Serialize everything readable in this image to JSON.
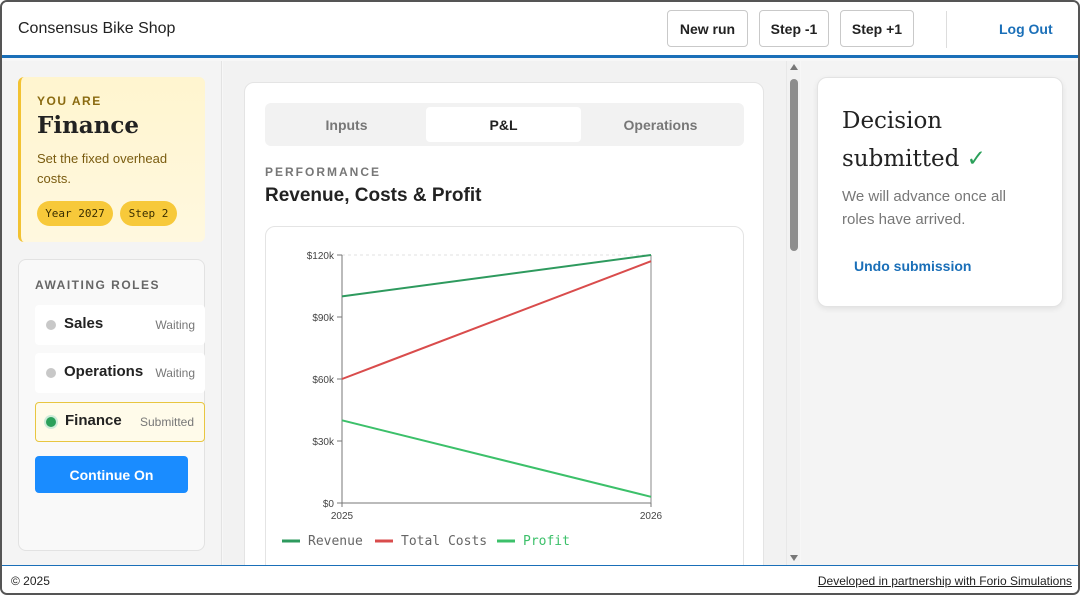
{
  "header": {
    "app_title": "Consensus Bike Shop",
    "new_run": "New run",
    "step_back": "Step -1",
    "step_forward": "Step +1",
    "logout": "Log Out"
  },
  "role_card": {
    "you_are": "YOU ARE",
    "role": "Finance",
    "description": "Set the fixed overhead costs.",
    "year_pill": "Year 2027",
    "step_pill": "Step 2"
  },
  "awaiting": {
    "title": "AWAITING ROLES",
    "roles": [
      {
        "name": "Sales",
        "status": "Waiting"
      },
      {
        "name": "Operations",
        "status": "Waiting"
      },
      {
        "name": "Finance",
        "status": "Submitted"
      }
    ],
    "continue": "Continue On"
  },
  "tabs": [
    "Inputs",
    "P&L",
    "Operations"
  ],
  "performance": {
    "label": "PERFORMANCE",
    "title": "Revenue, Costs & Profit"
  },
  "chart_data": {
    "type": "line",
    "x": [
      "2025",
      "2026"
    ],
    "ylim": [
      0,
      120000
    ],
    "yticks": [
      "$0",
      "$30k",
      "$60k",
      "$90k",
      "$120k"
    ],
    "series": [
      {
        "name": "Revenue",
        "values": [
          100000,
          120000
        ],
        "color": "#2e9a5e"
      },
      {
        "name": "Total Costs",
        "values": [
          60000,
          117000
        ],
        "color": "#d94c4c"
      },
      {
        "name": "Profit",
        "values": [
          40000,
          3000
        ],
        "color": "#3cc06a"
      }
    ],
    "legend_position": "bottom"
  },
  "decision": {
    "title": "Decision submitted",
    "check": "✓",
    "message": "We will advance once all roles have arrived.",
    "undo": "Undo submission"
  },
  "footer": {
    "copyright": "© 2025",
    "partner": "Developed in partnership with Forio Simulations"
  }
}
